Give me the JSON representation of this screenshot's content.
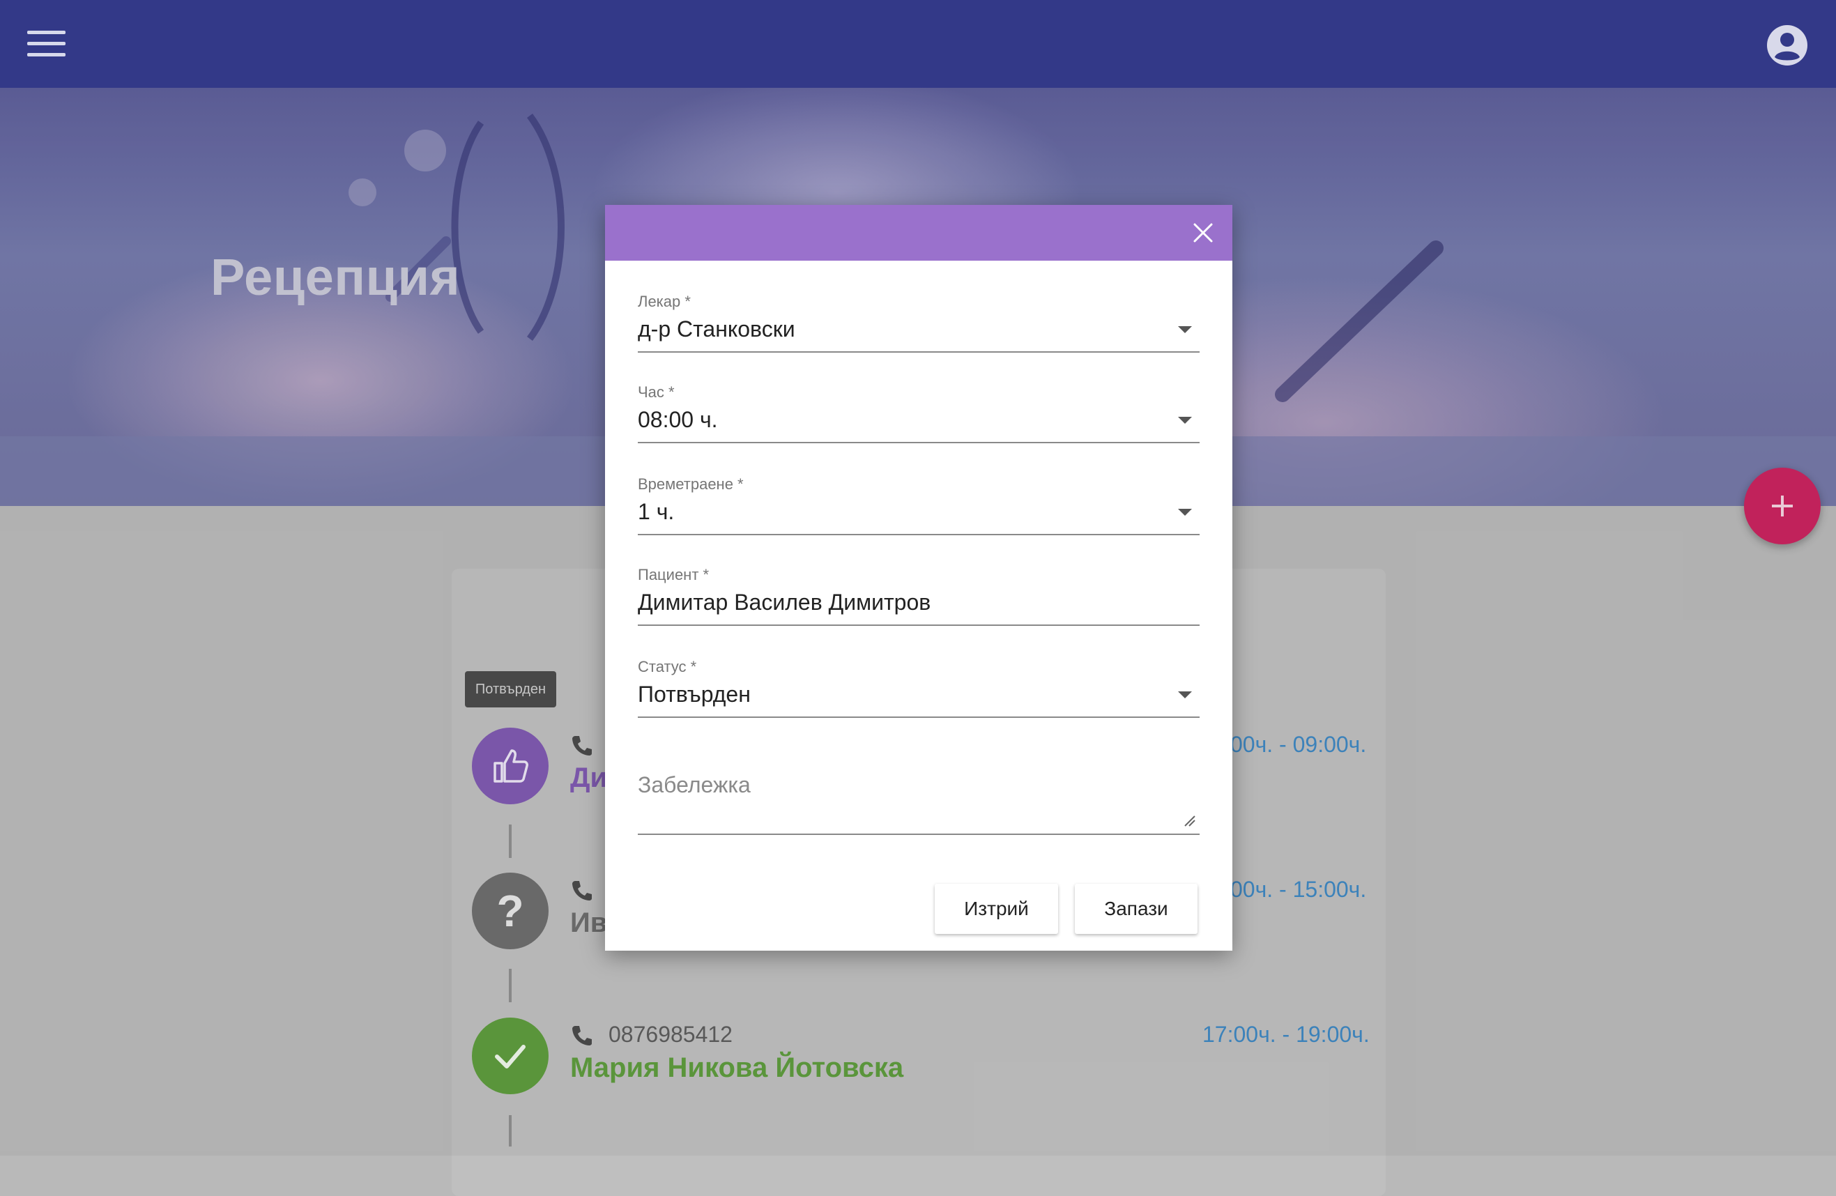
{
  "app": {
    "page_title": "Рецепция"
  },
  "colors": {
    "topbar": "#333988",
    "dialog_header": "#9a71cc",
    "fab": "#c9245f",
    "status_confirmed": "#7f5ab0",
    "status_unknown": "#6e6e6e",
    "status_done": "#5e9c3e",
    "time_text": "#3f88c2"
  },
  "icons": {
    "menu": "hamburger-menu-icon",
    "account": "account-circle-icon",
    "add": "plus-icon",
    "close": "close-icon",
    "phone": "phone-icon",
    "thumbs_up": "thumbs-up-icon",
    "question": "question-mark-icon",
    "check": "check-icon"
  },
  "tooltip": "Потвърден",
  "appointments": [
    {
      "status_icon": "thumbs-up-icon",
      "phone": "",
      "name": "Ди",
      "time": "00ч. - 09:00ч."
    },
    {
      "status_icon": "question-mark-icon",
      "phone": "",
      "name": "Ив",
      "time": "00ч. - 15:00ч."
    },
    {
      "status_icon": "check-icon",
      "phone": "0876985412",
      "name": "Мария Никова Йотовска",
      "time": "17:00ч. - 19:00ч."
    }
  ],
  "dialog": {
    "fields": {
      "doctor": {
        "label": "Лекар *",
        "value": "д-р Станковски"
      },
      "hour": {
        "label": "Час *",
        "value": "08:00 ч."
      },
      "duration": {
        "label": "Времетраене *",
        "value": "1 ч."
      },
      "patient": {
        "label": "Пациент *",
        "value": "Димитар  Василев Димитров"
      },
      "status": {
        "label": "Статус *",
        "value": "Потвърден"
      },
      "note": {
        "placeholder": "Забележка"
      }
    },
    "buttons": {
      "delete": "Изтрий",
      "save": "Запази"
    }
  }
}
